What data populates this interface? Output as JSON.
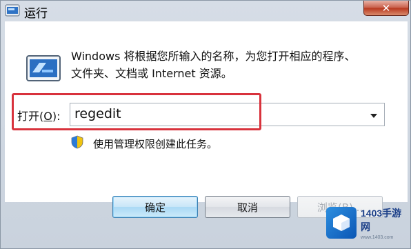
{
  "window": {
    "title": "运行",
    "close_symbol": "✕"
  },
  "description": {
    "line1": "Windows 将根据您所输入的名称，为您打开相应的程序、",
    "line2": "文件夹、文档或 Internet 资源。"
  },
  "open_field": {
    "label_prefix": "打开(",
    "label_accel": "O",
    "label_suffix": "):",
    "value": "regedit"
  },
  "admin_note": "使用管理权限创建此任务。",
  "buttons": {
    "ok": "确定",
    "cancel": "取消",
    "browse": "浏览(B)..."
  },
  "watermark": {
    "title": "1403手游网",
    "sub": "www.1403.com"
  },
  "icons": {
    "title": "run-icon",
    "main": "run-icon",
    "admin": "uac-shield-icon",
    "dropdown": "chevron-down-icon"
  },
  "colors": {
    "highlight": "#d8323c",
    "close": "#c9604b",
    "ok_button": "#a9d8f5"
  }
}
